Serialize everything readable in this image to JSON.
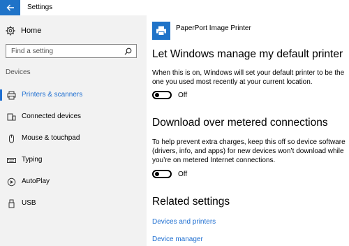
{
  "window": {
    "title": "Settings",
    "back_icon": "back-arrow-icon",
    "accent": "#1f73c8"
  },
  "sidebar": {
    "home_label": "Home",
    "search_placeholder": "Find a setting",
    "section": "Devices",
    "items": [
      {
        "label": "Printers & scanners",
        "icon": "printer-icon",
        "selected": true
      },
      {
        "label": "Connected devices",
        "icon": "connected-devices-icon",
        "selected": false
      },
      {
        "label": "Mouse & touchpad",
        "icon": "mouse-icon",
        "selected": false
      },
      {
        "label": "Typing",
        "icon": "keyboard-icon",
        "selected": false
      },
      {
        "label": "AutoPlay",
        "icon": "autoplay-icon",
        "selected": false
      },
      {
        "label": "USB",
        "icon": "usb-icon",
        "selected": false
      }
    ]
  },
  "main": {
    "printer_name": "PaperPort Image Printer",
    "default_printer": {
      "heading": "Let Windows manage my default printer",
      "description": "When this is on, Windows will set your default printer to be the one you used most recently at your current location.",
      "toggle_state": "Off"
    },
    "metered": {
      "heading": "Download over metered connections",
      "description": "To help prevent extra charges, keep this off so device software (drivers, info, and apps) for new devices won’t download while you’re on metered Internet connections.",
      "toggle_state": "Off"
    },
    "related": {
      "heading": "Related settings",
      "links": [
        "Devices and printers",
        "Device manager"
      ]
    }
  }
}
